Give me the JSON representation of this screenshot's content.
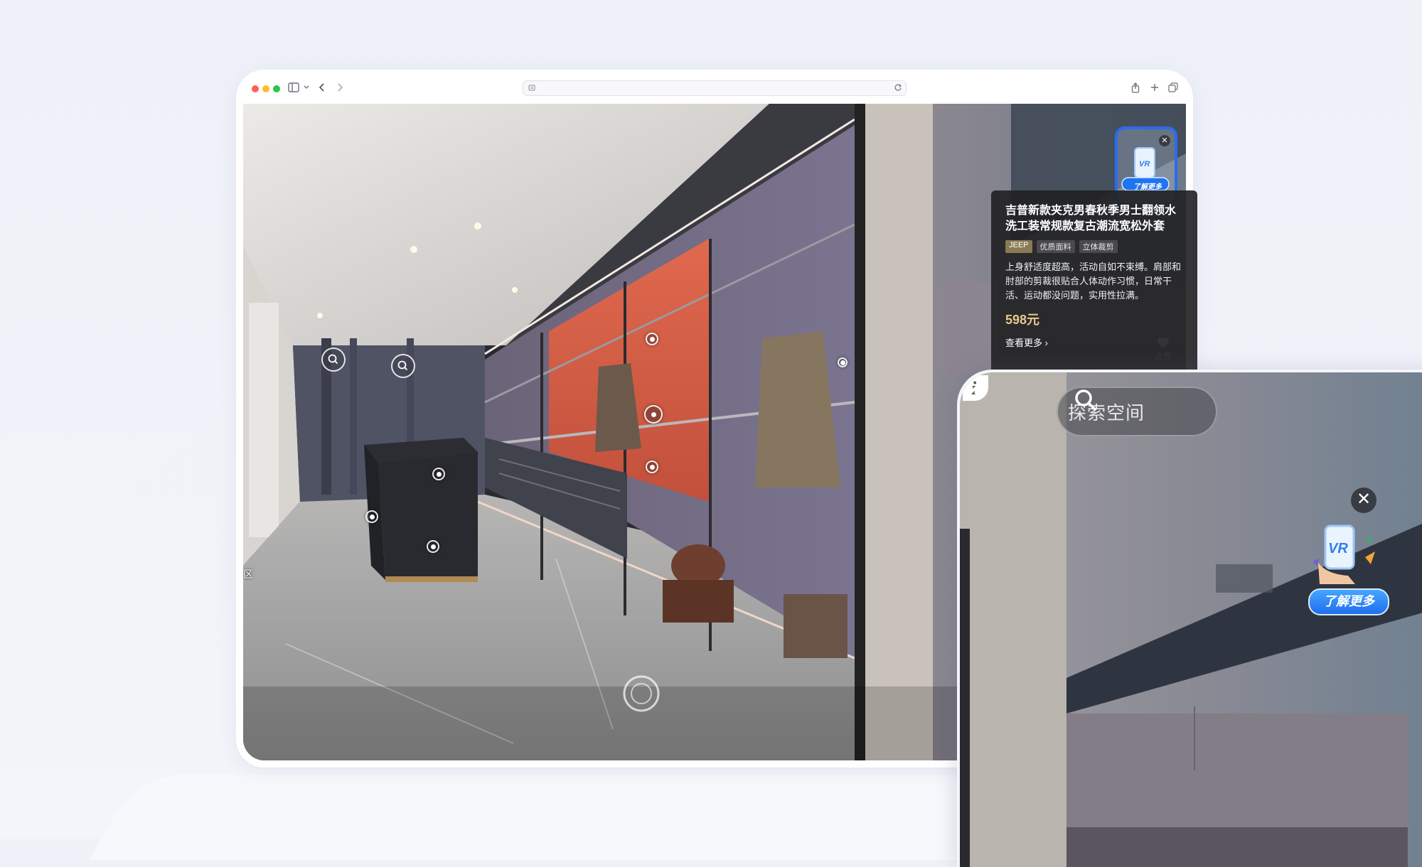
{
  "browser": {
    "url": "",
    "toolbar_icons": [
      "sidebar-icon",
      "chevron-down-icon",
      "back-icon",
      "forward-icon",
      "share-icon",
      "new-tab-icon",
      "tabs-icon"
    ]
  },
  "scene": {
    "zone_label": "区",
    "product_card": {
      "title": "吉普新款夹克男春秋季男士翻领水洗工装常规款复古潮流宽松外套",
      "tags": [
        "JEEP",
        "优质面料",
        "立体裁剪"
      ],
      "description": "上身舒适度超高，活动自如不束缚。肩部和肘部的剪裁很贴合人体动作习惯，日常干活、运动都没问题，实用性拉满。",
      "price": "598元",
      "more_label": "查看更多 ›"
    },
    "vr_badge_small": {
      "label": "了解更多",
      "vr": "VR"
    },
    "like_label": "点赞"
  },
  "phone_panel": {
    "search_label": "探索空间",
    "vr_badge": {
      "label": "了解更多",
      "vr": "VR"
    }
  },
  "colors": {
    "accent_blue": "#2a6cf0",
    "price_gold": "#e8c98a",
    "brand_tag": "#8a7a54"
  }
}
